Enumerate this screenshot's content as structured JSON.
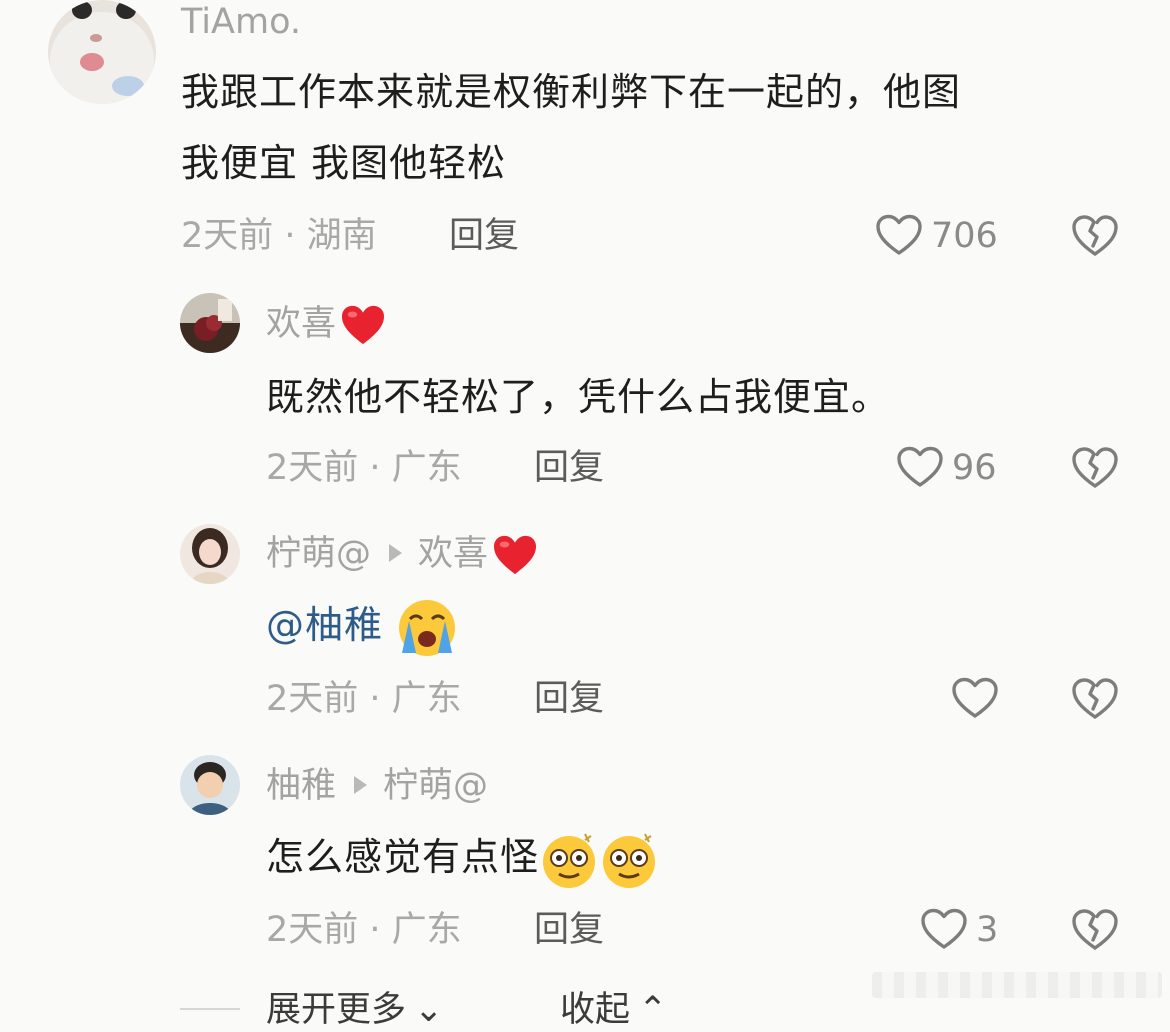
{
  "comments": [
    {
      "username": "TiAmo.",
      "text_line1": "我跟工作本来就是权衡利弊下在一起的，他图",
      "text_line2": "我便宜 我图他轻松",
      "meta": "2天前 · 湖南",
      "reply_label": "回复",
      "likes": "706"
    },
    {
      "username": "欢喜",
      "text": "既然他不轻松了，凭什么占我便宜。",
      "meta": "2天前 · 广东",
      "reply_label": "回复",
      "likes": "96"
    },
    {
      "username": "柠萌@",
      "reply_to": "欢喜",
      "mention": "@柚稚",
      "meta": "2天前 · 广东",
      "reply_label": "回复",
      "likes": ""
    },
    {
      "username": "柚稚",
      "reply_to": "柠萌@",
      "text": "怎么感觉有点怪",
      "meta": "2天前 · 广东",
      "reply_label": "回复",
      "likes": "3"
    }
  ],
  "footer": {
    "expand_label": "展开更多",
    "collapse_label": "收起"
  },
  "icons": {
    "like": "heart-outline-icon",
    "dislike": "broken-heart-icon",
    "reply_arrow": "triangle-right-icon",
    "red_heart": "red-heart-emoji",
    "crying_emoji": "loudly-crying-emoji",
    "dizzy_emoji": "dizzy-face-emoji"
  },
  "colors": {
    "background": "#fafaf8",
    "username": "#a3a3a3",
    "mention": "#2e5c8a",
    "meta": "#a8a8a8",
    "red_heart": "#e8222f"
  }
}
